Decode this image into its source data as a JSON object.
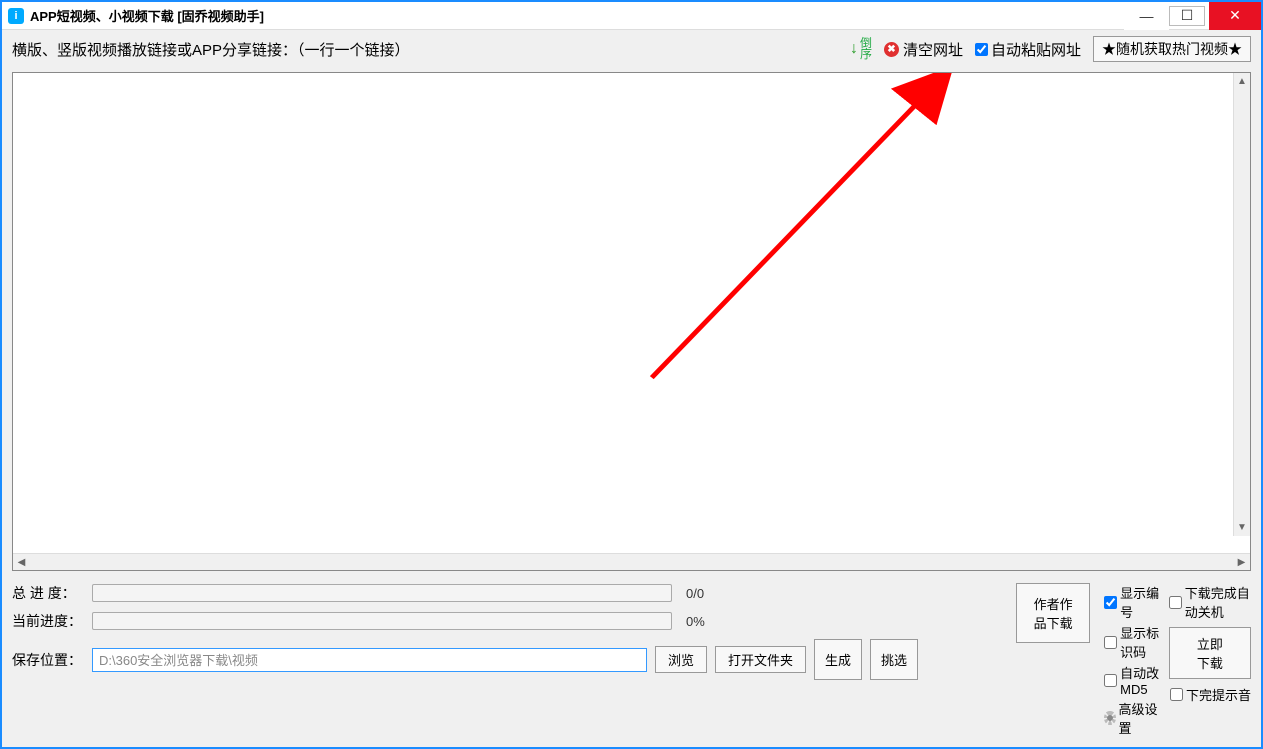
{
  "title": "APP短视频、小视频下载 [固乔视频助手]",
  "toolbar": {
    "instruction": "横版、竖版视频播放链接或APP分享链接：（一行一个链接）",
    "reverse_label": "倒序",
    "clear_label": "清空网址",
    "auto_paste_label": "自动粘贴网址",
    "auto_paste_checked": true,
    "random_label": "★随机获取热门视频★"
  },
  "progress": {
    "total_label": "总 进 度：",
    "total_text": "0/0",
    "current_label": "当前进度：",
    "current_text": "0%"
  },
  "save": {
    "label": "保存位置：",
    "path": "D:\\360安全浏览器下载\\视频",
    "browse_label": "浏览",
    "open_folder_label": "打开文件夹"
  },
  "buttons": {
    "author_works": "作者作品下载",
    "generate": "生成",
    "pick": "挑选",
    "download_now": "立即下载"
  },
  "options": {
    "show_number": "显示编号",
    "show_number_checked": true,
    "show_tag": "显示标识码",
    "show_tag_checked": false,
    "auto_md5": "自动改MD5",
    "auto_md5_checked": false,
    "advanced": "高级设置",
    "auto_shutdown": "下载完成自动关机",
    "auto_shutdown_checked": false,
    "done_sound": "下完提示音",
    "done_sound_checked": false
  }
}
